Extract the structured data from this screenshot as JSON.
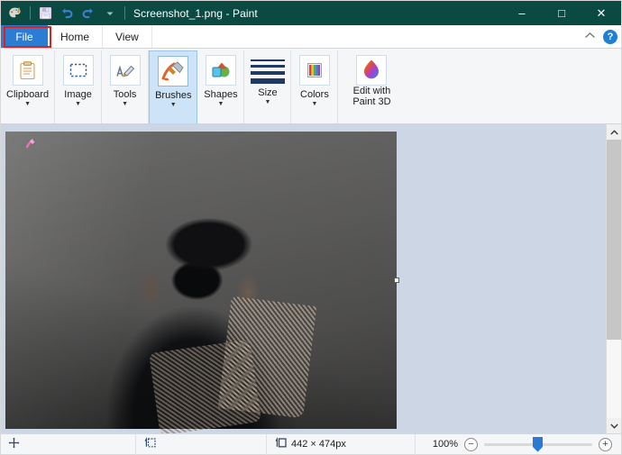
{
  "window": {
    "title": "Screenshot_1.png - Paint",
    "app_icon": "paint-palette-icon",
    "quick_access": [
      {
        "name": "save-icon",
        "label": "Save"
      },
      {
        "name": "undo-icon",
        "label": "Undo"
      },
      {
        "name": "redo-icon",
        "label": "Redo"
      },
      {
        "name": "chevron-down-icon",
        "label": "Customize Quick Access Toolbar"
      }
    ],
    "controls": {
      "minimize": "–",
      "maximize": "□",
      "close": "✕"
    }
  },
  "tabs": {
    "file": "File",
    "items": [
      {
        "label": "Home"
      },
      {
        "label": "View"
      }
    ],
    "collapse_icon": "chevron-up-icon",
    "help_label": "?",
    "annotation_color": "#e02020",
    "file_tab_color": "#2b7cd3"
  },
  "ribbon": {
    "groups": [
      {
        "label": "Clipboard",
        "icon": "clipboard-icon",
        "caret": true,
        "selected": false
      },
      {
        "label": "Image",
        "icon": "select-rectangle-icon",
        "caret": true,
        "selected": false
      },
      {
        "label": "Tools",
        "icon": "pencil-text-icon",
        "caret": true,
        "selected": false
      },
      {
        "label": "Brushes",
        "icon": "paintbrush-icon",
        "caret": true,
        "selected": true
      },
      {
        "label": "Shapes",
        "icon": "shapes-icon",
        "caret": true,
        "selected": false
      },
      {
        "label": "Size",
        "icon": "line-thickness-icon",
        "caret": true,
        "selected": false
      },
      {
        "label": "Colors",
        "icon": "color-palette-icon",
        "caret": true,
        "selected": false
      }
    ],
    "paint3d": {
      "line1": "Edit with",
      "line2": "Paint 3D",
      "icon": "paint-3d-icon"
    }
  },
  "canvas": {
    "cursor_icon": "brush-cursor-icon",
    "resize_handle": "resize-handle-east",
    "image_alt": "photographer-with-camera-photo"
  },
  "scrollbar": {
    "up_icon": "chevron-up-icon",
    "down_icon": "chevron-down-icon"
  },
  "statusbar": {
    "position_icon": "cursor-position-icon",
    "position_value": "",
    "selection_icon": "selection-size-icon",
    "selection_value": "",
    "size_icon": "image-size-icon",
    "size_value": "442 × 474px",
    "zoom": {
      "percent": "100%",
      "minus": "−",
      "plus": "+"
    }
  }
}
